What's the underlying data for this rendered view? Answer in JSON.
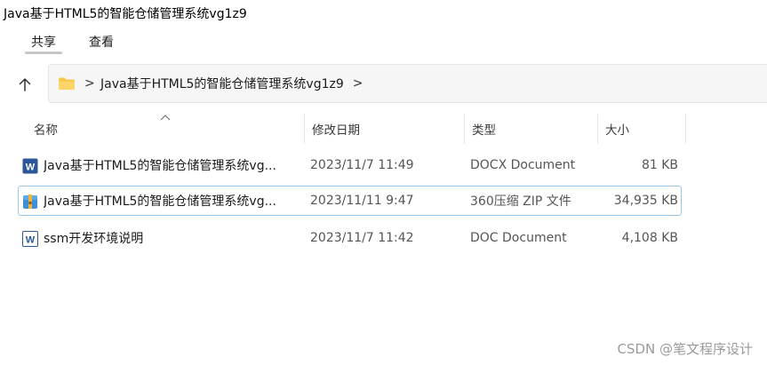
{
  "window": {
    "title": "Java基于HTML5的智能仓储管理系统vg1z9"
  },
  "ribbon": {
    "tabs": [
      {
        "label": "共享"
      },
      {
        "label": "查看"
      }
    ]
  },
  "address_bar": {
    "breadcrumb": [
      {
        "label": "Java基于HTML5的智能仓储管理系统vg1z9"
      }
    ],
    "separator": ">",
    "trailing_separator": ">"
  },
  "columns": [
    {
      "label": "名称"
    },
    {
      "label": "修改日期"
    },
    {
      "label": "类型"
    },
    {
      "label": "大小"
    }
  ],
  "files": [
    {
      "name": "Java基于HTML5的智能仓储管理系统vg...",
      "modified": "2023/11/7 11:49",
      "type": "DOCX Document",
      "size": "81 KB",
      "icon": "word-doc-icon"
    },
    {
      "name": "Java基于HTML5的智能仓储管理系统vg...",
      "modified": "2023/11/11 9:47",
      "type": "360压缩 ZIP 文件",
      "size": "34,935 KB",
      "icon": "zip-archive-icon"
    },
    {
      "name": "ssm开发环境说明",
      "modified": "2023/11/7 11:42",
      "type": "DOC Document",
      "size": "4,108 KB",
      "icon": "word-doc-icon"
    }
  ],
  "selection": {
    "selected_row": 1
  },
  "watermark": "CSDN @笔文程序设计",
  "colors": {
    "word_blue": "#2b579a",
    "folder_yellow": "#f8c74a",
    "selection_border": "#99c9ee"
  }
}
